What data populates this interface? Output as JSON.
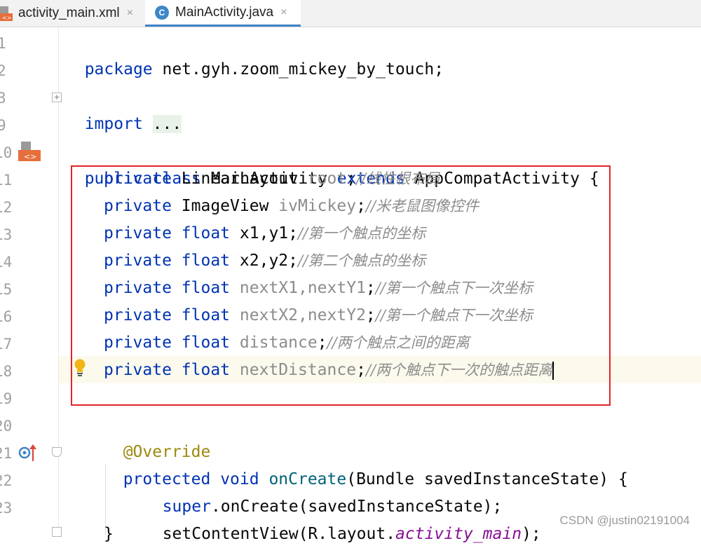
{
  "tabs": [
    {
      "label": "activity_main.xml",
      "close": "×",
      "active": false
    },
    {
      "label": "MainActivity.java",
      "close": "×",
      "active": true,
      "icon_letter": "C"
    }
  ],
  "line_numbers": [
    "1",
    "2",
    "3",
    "9",
    "10",
    "11",
    "12",
    "13",
    "14",
    "15",
    "16",
    "17",
    "18",
    "19",
    "20",
    "21",
    "22",
    "23"
  ],
  "code": {
    "l1": {
      "kw": "package",
      "rest": " net.gyh.zoom_mickey_by_touch;"
    },
    "l3": {
      "kw": "import",
      "fold": "..."
    },
    "l10": {
      "kw1": "public",
      "kw2": "class",
      "name": "MainActivity",
      "kw3": "extends",
      "parent": "AppCompatActivity",
      "brace": "{"
    },
    "fields": [
      {
        "mod": "private",
        "type": "LinearLayout",
        "type_kw": false,
        "names": "root",
        "names_gray": true,
        "comment": "//线性根布局"
      },
      {
        "mod": "private",
        "type": "ImageView",
        "type_kw": false,
        "names": "ivMickey",
        "names_gray": true,
        "comment": "//米老鼠图像控件"
      },
      {
        "mod": "private",
        "type": "float",
        "type_kw": true,
        "names": "x1,y1",
        "names_gray": false,
        "comment": "//第一个触点的坐标"
      },
      {
        "mod": "private",
        "type": "float",
        "type_kw": true,
        "names": "x2,y2",
        "names_gray": false,
        "comment": "//第二个触点的坐标"
      },
      {
        "mod": "private",
        "type": "float",
        "type_kw": true,
        "names": "nextX1,nextY1",
        "names_gray": true,
        "comment": "//第一个触点下一次坐标"
      },
      {
        "mod": "private",
        "type": "float",
        "type_kw": true,
        "names": "nextX2,nextY2",
        "names_gray": true,
        "comment": "//第一个触点下一次坐标"
      },
      {
        "mod": "private",
        "type": "float",
        "type_kw": true,
        "names": "distance",
        "names_gray": true,
        "comment": "//两个触点之间的距离"
      },
      {
        "mod": "private",
        "type": "float",
        "type_kw": true,
        "names": "nextDistance",
        "names_gray": true,
        "comment": "//两个触点下一次的触点距离"
      }
    ],
    "l20": {
      "annotation": "@Override"
    },
    "l21": {
      "kw1": "protected",
      "kw2": "void",
      "method": "onCreate",
      "params": "(Bundle savedInstanceState) {"
    },
    "l22": {
      "kw": "super",
      "rest": ".onCreate(savedInstanceState);"
    },
    "l23": {
      "pre": "setContentView(R.layout.",
      "field": "activity_main",
      "post": ");"
    }
  },
  "watermark": "CSDN @justin02191004",
  "colors": {
    "keyword": "#0033b3",
    "comment": "#8c8c8c",
    "annotation": "#9e880d",
    "highlight_box": "#e0242c",
    "tab_accent": "#4083c9"
  }
}
